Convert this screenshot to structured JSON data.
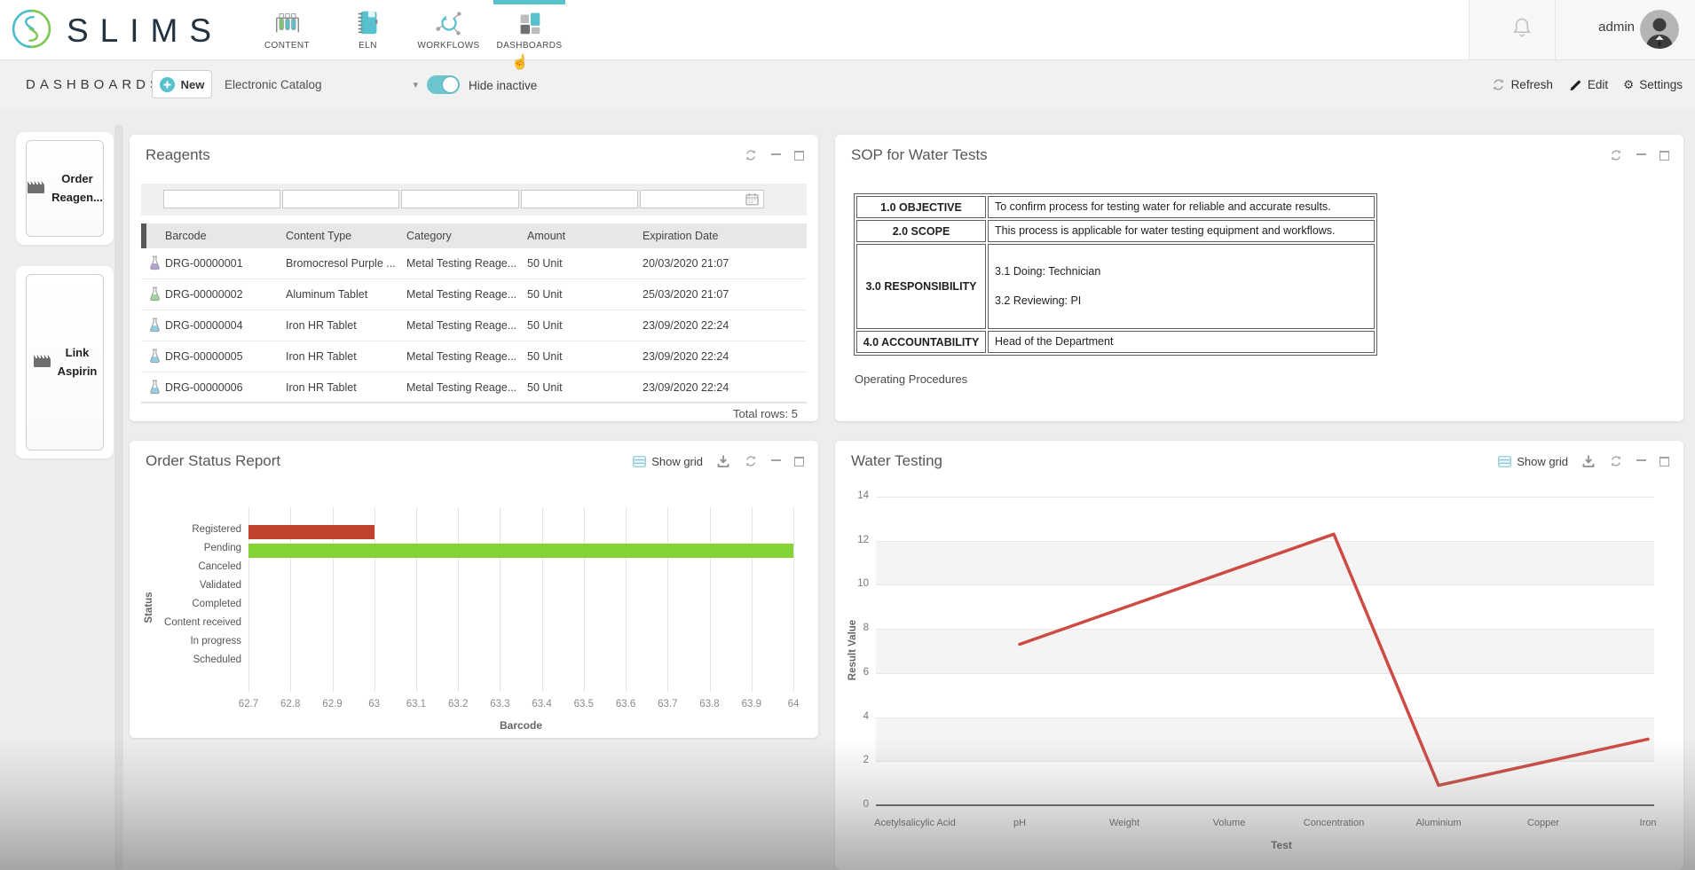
{
  "brand": {
    "name": "SLIMS",
    "teal": "#57c1ce",
    "green": "#7dc855"
  },
  "glyphs": {
    "caret_down": "▾",
    "gear": "⚙",
    "cursor_hand": "☝"
  },
  "topbar": {
    "nav": [
      {
        "label": "CONTENT",
        "icon": "test-tubes-icon",
        "active": false
      },
      {
        "label": "ELN",
        "icon": "notebook-icon",
        "active": false
      },
      {
        "label": "WORKFLOWS",
        "icon": "workflow-icon",
        "active": false
      },
      {
        "label": "DASHBOARDS",
        "icon": "dashboard-grid-icon",
        "active": true
      }
    ],
    "user": {
      "name": "admin"
    }
  },
  "toolbar": {
    "title": "DASHBOARDS",
    "new_button": "New",
    "dashboard_select": {
      "value": "Electronic Catalog"
    },
    "hide_inactive": {
      "label": "Hide inactive",
      "on": true
    },
    "actions": [
      {
        "label": "Refresh",
        "icon": "refresh-icon"
      },
      {
        "label": "Edit",
        "icon": "pencil-icon"
      },
      {
        "label": "Settings",
        "icon": "gear-icon"
      }
    ]
  },
  "sidebar": {
    "cards": [
      {
        "line1": "Order",
        "line2": "Reagen...",
        "icon": "clapper-icon"
      },
      {
        "line1": "Link",
        "line2": "Aspirin",
        "icon": "clapper-icon"
      }
    ]
  },
  "reagents": {
    "title": "Reagents",
    "columns": [
      "Barcode",
      "Content Type",
      "Category",
      "Amount",
      "Expiration Date"
    ],
    "rows": [
      {
        "icon_color": "#b3a0d6",
        "barcode": "DRG-00000001",
        "content_type": "Bromocresol Purple ...",
        "category": "Metal Testing Reage...",
        "amount": "50 Unit",
        "expiration": "20/03/2020 21:07"
      },
      {
        "icon_color": "#9fd69b",
        "barcode": "DRG-00000002",
        "content_type": "Aluminum Tablet",
        "category": "Metal Testing Reage...",
        "amount": "50 Unit",
        "expiration": "25/03/2020 21:07"
      },
      {
        "icon_color": "#8fd0e8",
        "barcode": "DRG-00000004",
        "content_type": "Iron HR Tablet",
        "category": "Metal Testing Reage...",
        "amount": "50 Unit",
        "expiration": "23/09/2020 22:24"
      },
      {
        "icon_color": "#8fd0e8",
        "barcode": "DRG-00000005",
        "content_type": "Iron HR Tablet",
        "category": "Metal Testing Reage...",
        "amount": "50 Unit",
        "expiration": "23/09/2020 22:24"
      },
      {
        "icon_color": "#8fd0e8",
        "barcode": "DRG-00000006",
        "content_type": "Iron HR Tablet",
        "category": "Metal Testing Reage...",
        "amount": "50 Unit",
        "expiration": "23/09/2020 22:24"
      }
    ],
    "total_rows": "Total rows: 5"
  },
  "sop": {
    "title": "SOP for Water Tests",
    "rows": [
      {
        "heading": "1.0 OBJECTIVE",
        "content": "To confirm process for testing water for reliable and accurate results."
      },
      {
        "heading": "2.0 SCOPE",
        "content": "This process is applicable for water testing equipment and workflows."
      },
      {
        "heading": "3.0 RESPONSIBILITY",
        "content": [
          "3.1 Doing: Technician",
          "3.2 Reviewing: PI"
        ]
      },
      {
        "heading": "4.0 ACCOUNTABILITY",
        "content": "Head of the Department"
      }
    ],
    "footer_text": "Operating Procedures"
  },
  "order_status": {
    "title": "Order Status Report",
    "show_grid": "Show grid"
  },
  "water_testing": {
    "title": "Water Testing",
    "show_grid": "Show grid"
  },
  "chart_data": [
    {
      "panel": "Order Status Report",
      "type": "bar",
      "orientation": "horizontal",
      "categories": [
        "Registered",
        "Pending",
        "Canceled",
        "Validated",
        "Completed",
        "Content received",
        "In progress",
        "Scheduled"
      ],
      "values": [
        63,
        64,
        null,
        null,
        null,
        null,
        null,
        null
      ],
      "bar_colors": [
        "#c0432f",
        "#85d435",
        null,
        null,
        null,
        null,
        null,
        null
      ],
      "xlabel": "Barcode",
      "ylabel": "Status",
      "xlim": [
        62.7,
        64
      ],
      "xticks": [
        "62.7",
        "62.8",
        "62.9",
        "63",
        "63.1",
        "63.2",
        "63.3",
        "63.4",
        "63.5",
        "63.6",
        "63.7",
        "63.8",
        "63.9",
        "64"
      ],
      "grid": true,
      "legend": false
    },
    {
      "panel": "Water Testing",
      "type": "line",
      "categories": [
        "Acetylsalicylic Acid",
        "pH",
        "Weight",
        "Volume",
        "Concentration",
        "Aluminium",
        "Copper",
        "Iron"
      ],
      "points": [
        {
          "category": "pH",
          "value": 7.3
        },
        {
          "category": "Concentration",
          "value": 12.3
        },
        {
          "category": "Aluminium",
          "value": 0.9
        },
        {
          "category": "Iron",
          "value": 3
        }
      ],
      "xlabel": "Test",
      "ylabel": "Result Value",
      "ylim": [
        0,
        14
      ],
      "yticks": [
        "14",
        "12",
        "10",
        "8",
        "6",
        "4",
        "2",
        "0"
      ],
      "line_color": "#cd4b42",
      "band_color": "#f4f4f4",
      "bands": [
        [
          2,
          4
        ],
        [
          6,
          8
        ],
        [
          10,
          12
        ]
      ],
      "grid": true,
      "legend": false
    }
  ]
}
